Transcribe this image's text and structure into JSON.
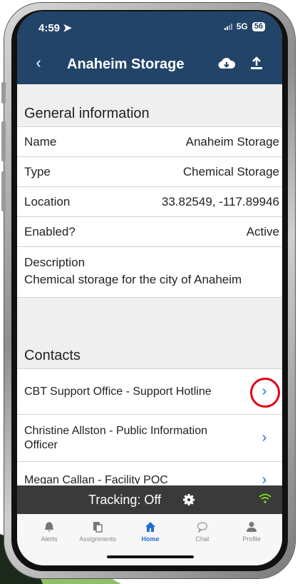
{
  "status_bar": {
    "time": "4:59",
    "network": "5G",
    "battery": "56"
  },
  "header": {
    "title": "Anaheim Storage"
  },
  "general": {
    "section_title": "General information",
    "rows": [
      {
        "label": "Name",
        "value": "Anaheim Storage"
      },
      {
        "label": "Type",
        "value": "Chemical Storage"
      },
      {
        "label": "Location",
        "value": "33.82549, -117.89946"
      },
      {
        "label": "Enabled?",
        "value": "Active"
      }
    ],
    "description_label": "Description",
    "description_value": "Chemical storage for the city of Anaheim"
  },
  "contacts": {
    "section_title": "Contacts",
    "items": [
      {
        "name": "CBT Support Office - Support Hotline"
      },
      {
        "name": "Christine Allston - Public Information Officer"
      },
      {
        "name": "Megan Callan - Facility POC"
      }
    ]
  },
  "tracking": {
    "label": "Tracking:  Off"
  },
  "tabs": [
    {
      "label": "Alerts",
      "icon": "bell-icon"
    },
    {
      "label": "Assignments",
      "icon": "clipboard-icon"
    },
    {
      "label": "Home",
      "icon": "home-icon",
      "active": true
    },
    {
      "label": "Chat",
      "icon": "chat-bubble-icon"
    },
    {
      "label": "Profile",
      "icon": "person-icon"
    }
  ],
  "colors": {
    "header": "#234469",
    "accent": "#1f6fd1",
    "tracking_bar": "#3a3a3a",
    "highlight": "#e0001a",
    "wifi": "#7bd321"
  }
}
